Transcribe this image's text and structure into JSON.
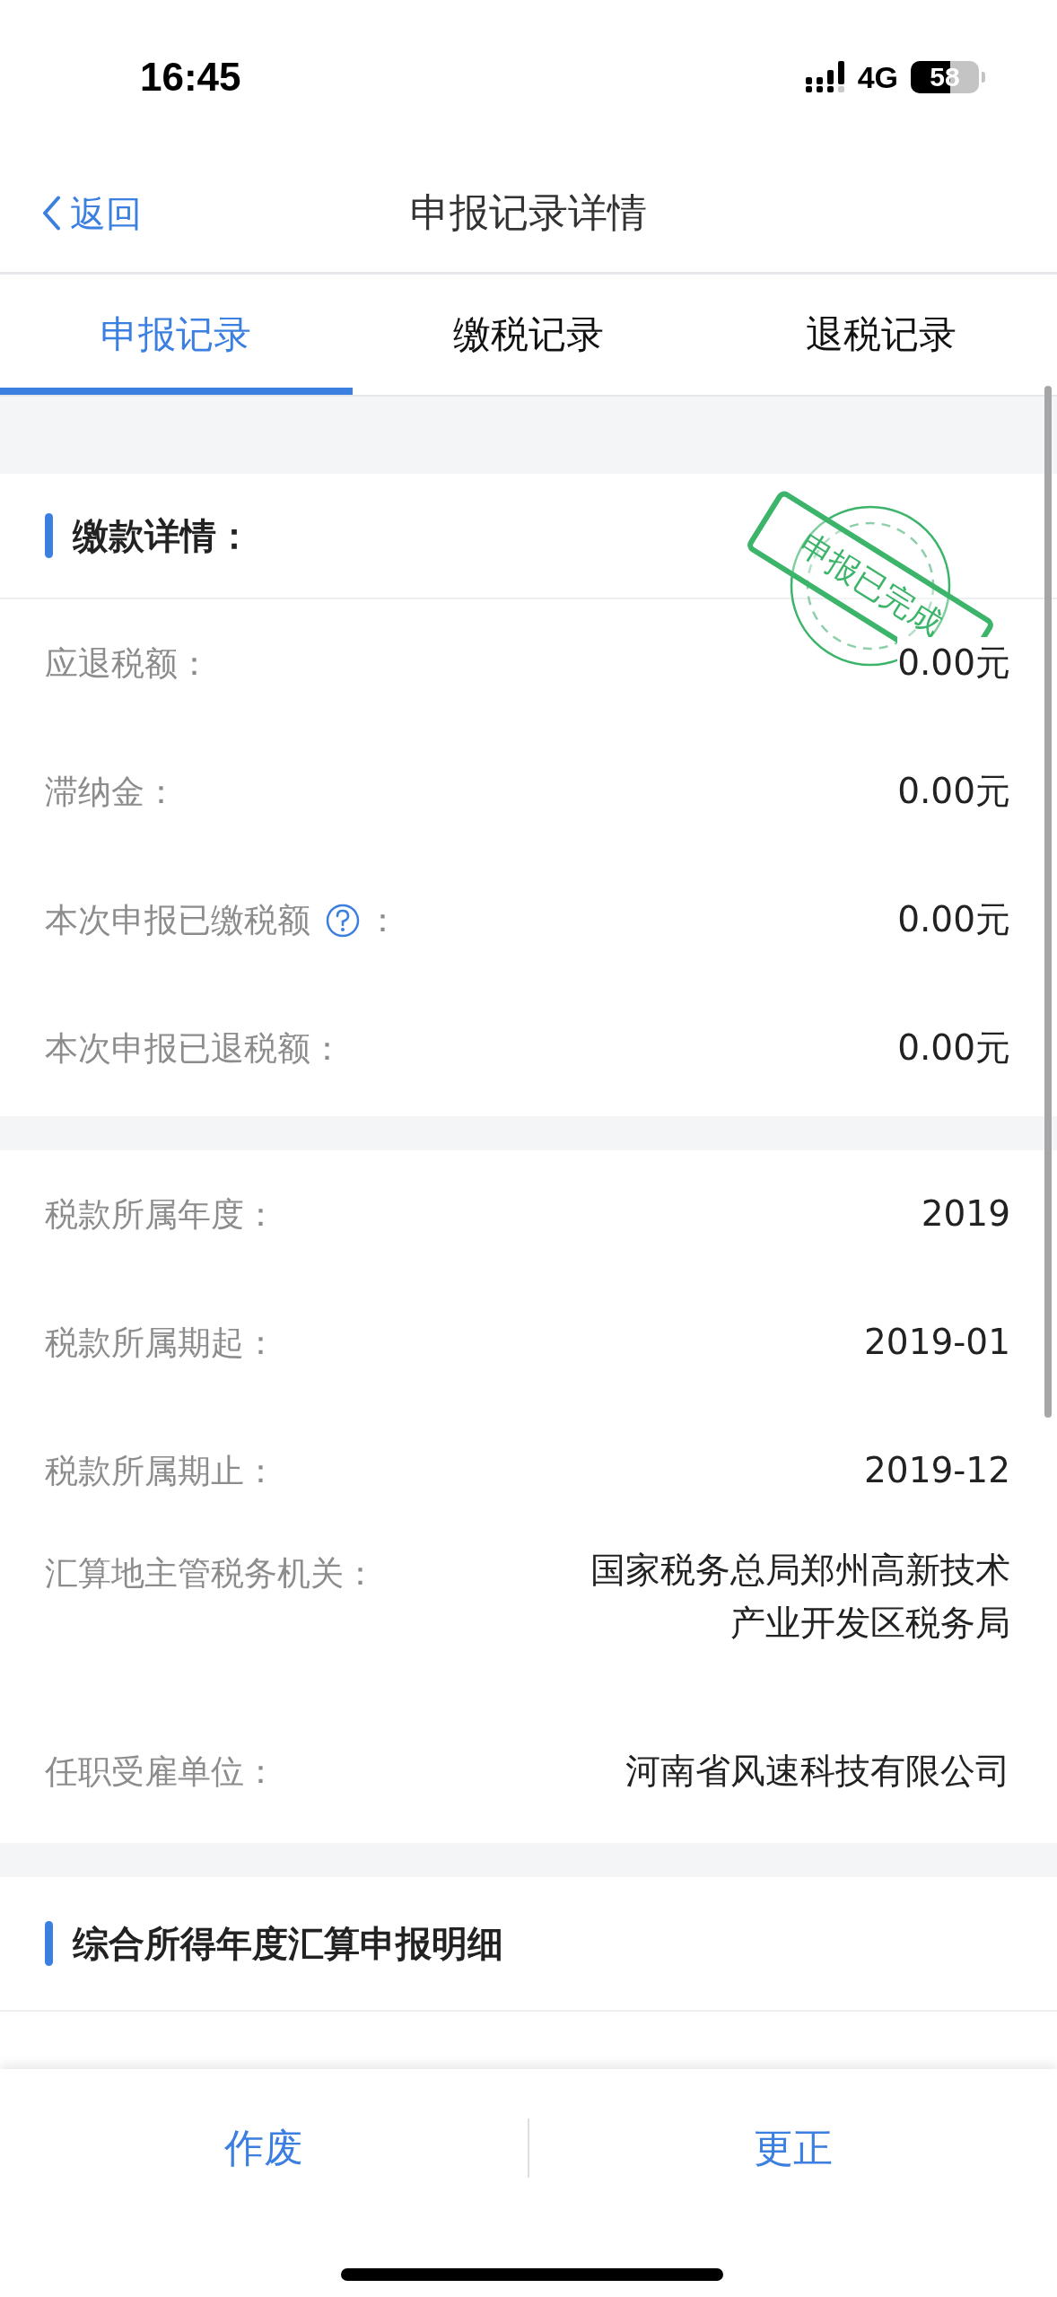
{
  "status_bar": {
    "time": "16:45",
    "network": "4G",
    "battery": "58"
  },
  "nav": {
    "back": "返回",
    "title": "申报记录详情"
  },
  "tabs": [
    {
      "label": "申报记录",
      "selected": true
    },
    {
      "label": "缴税记录",
      "selected": false
    },
    {
      "label": "退税记录",
      "selected": false
    }
  ],
  "payment_section": {
    "title": "缴款详情：",
    "stamp": "申报已完成",
    "rows": [
      {
        "label": "应退税额：",
        "help": false,
        "value": "0.00元"
      },
      {
        "label": "滞纳金：",
        "help": false,
        "value": "0.00元"
      },
      {
        "label": "本次申报已缴税额",
        "help": true,
        "colon": "：",
        "value": "0.00元"
      },
      {
        "label": "本次申报已退税额：",
        "help": false,
        "value": "0.00元"
      }
    ]
  },
  "info_section": {
    "rows": [
      {
        "label": "税款所属年度：",
        "lines": [
          "2019"
        ]
      },
      {
        "label": "税款所属期起：",
        "lines": [
          "2019-01"
        ]
      },
      {
        "label": "税款所属期止：",
        "lines": [
          "2019-12"
        ]
      },
      {
        "label": "汇算地主管税务机关：",
        "lines": [
          "国家税务总局郑州高新技术",
          "产业开发区税务局"
        ]
      },
      {
        "label": "任职受雇单位：",
        "lines": [
          "河南省风速科技有限公司"
        ]
      }
    ]
  },
  "detail_section": {
    "title": "综合所得年度汇算申报明细"
  },
  "actions": [
    "作废",
    "更正"
  ]
}
